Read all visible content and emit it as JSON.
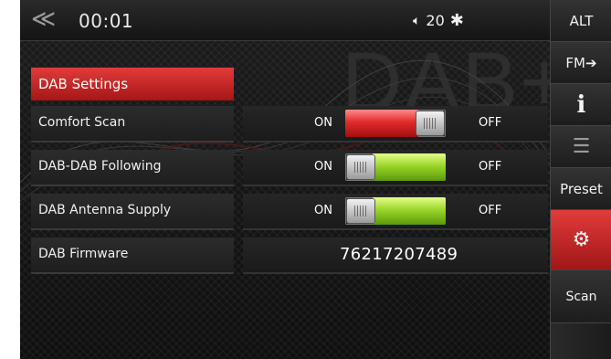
{
  "header": {
    "back_icon": "back-chevron-icon",
    "time": "00:01",
    "volume": "20",
    "volume_icon": "speaker-volume-icon",
    "bluetooth_icon": "bluetooth-icon",
    "watermark": "DAB+"
  },
  "settings": {
    "title": "DAB Settings",
    "rows": [
      {
        "label": "Comfort Scan",
        "on": "ON",
        "off": "OFF",
        "state": "on",
        "color": "#e22b2b"
      },
      {
        "label": "DAB-DAB Following",
        "on": "ON",
        "off": "OFF",
        "state": "off",
        "color": "#9bd62a"
      },
      {
        "label": "DAB Antenna Supply",
        "on": "ON",
        "off": "OFF",
        "state": "off",
        "color": "#9bd62a"
      },
      {
        "label": "DAB Firmware",
        "value": "76217207489"
      }
    ]
  },
  "sidebar": {
    "items": [
      {
        "label": "ALT"
      },
      {
        "label": "FM➔"
      },
      {
        "icon": "info-icon"
      },
      {
        "icon": "list-icon"
      },
      {
        "label": "Preset"
      },
      {
        "icon": "gear-icon",
        "active": true
      },
      {
        "label": "Scan"
      }
    ]
  },
  "colors": {
    "accent_red": "#e22b2b",
    "toggle_green": "#9bd62a",
    "background": "#111111"
  }
}
